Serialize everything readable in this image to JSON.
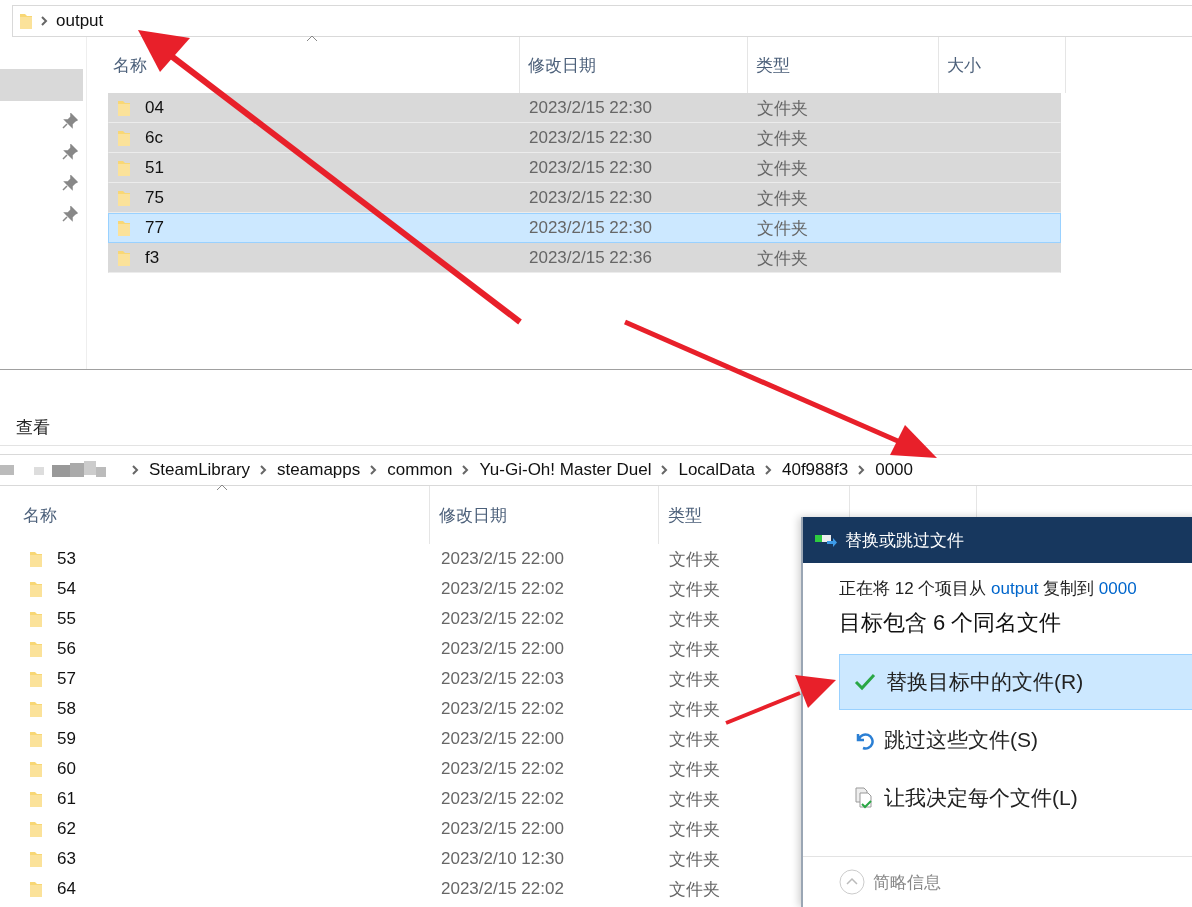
{
  "top_window": {
    "address": [
      "output"
    ],
    "columns": [
      "名称",
      "修改日期",
      "类型",
      "大小"
    ],
    "rows": [
      {
        "name": "04",
        "modified": "2023/2/15 22:30",
        "type": "文件夹",
        "selected": true,
        "focused": false
      },
      {
        "name": "6c",
        "modified": "2023/2/15 22:30",
        "type": "文件夹",
        "selected": true,
        "focused": false
      },
      {
        "name": "51",
        "modified": "2023/2/15 22:30",
        "type": "文件夹",
        "selected": true,
        "focused": false
      },
      {
        "name": "75",
        "modified": "2023/2/15 22:30",
        "type": "文件夹",
        "selected": true,
        "focused": false
      },
      {
        "name": "77",
        "modified": "2023/2/15 22:30",
        "type": "文件夹",
        "selected": true,
        "focused": true
      },
      {
        "name": "f3",
        "modified": "2023/2/15 22:36",
        "type": "文件夹",
        "selected": true,
        "focused": false
      }
    ]
  },
  "bottom_window": {
    "ribbon_tab": "查看",
    "breadcrumb": [
      "SteamLibrary",
      "steamapps",
      "common",
      "Yu-Gi-Oh!  Master Duel",
      "LocalData",
      "40f988f3",
      "0000"
    ],
    "columns": [
      "名称",
      "修改日期",
      "类型"
    ],
    "rows": [
      {
        "name": "53",
        "modified": "2023/2/15 22:00",
        "type": "文件夹"
      },
      {
        "name": "54",
        "modified": "2023/2/15 22:02",
        "type": "文件夹"
      },
      {
        "name": "55",
        "modified": "2023/2/15 22:02",
        "type": "文件夹"
      },
      {
        "name": "56",
        "modified": "2023/2/15 22:00",
        "type": "文件夹"
      },
      {
        "name": "57",
        "modified": "2023/2/15 22:03",
        "type": "文件夹"
      },
      {
        "name": "58",
        "modified": "2023/2/15 22:02",
        "type": "文件夹"
      },
      {
        "name": "59",
        "modified": "2023/2/15 22:00",
        "type": "文件夹"
      },
      {
        "name": "60",
        "modified": "2023/2/15 22:02",
        "type": "文件夹"
      },
      {
        "name": "61",
        "modified": "2023/2/15 22:02",
        "type": "文件夹"
      },
      {
        "name": "62",
        "modified": "2023/2/15 22:00",
        "type": "文件夹"
      },
      {
        "name": "63",
        "modified": "2023/2/10 12:30",
        "type": "文件夹"
      },
      {
        "name": "64",
        "modified": "2023/2/15 22:02",
        "type": "文件夹"
      }
    ]
  },
  "dialog": {
    "title": "替换或跳过文件",
    "message": [
      {
        "text": "正在将 12 个项目从",
        "kind": "plain"
      },
      {
        "text": "output",
        "kind": "link"
      },
      {
        "text": "复制到",
        "kind": "plain"
      },
      {
        "text": "0000",
        "kind": "link"
      }
    ],
    "heading": "目标包含 6 个同名文件",
    "options": [
      {
        "label": "替换目标中的文件(R)",
        "kind": "replace",
        "selected": true
      },
      {
        "label": "跳过这些文件(S)",
        "kind": "skip",
        "selected": false
      },
      {
        "label": "让我决定每个文件(L)",
        "kind": "decide",
        "selected": false
      }
    ],
    "footer": "简略信息"
  }
}
